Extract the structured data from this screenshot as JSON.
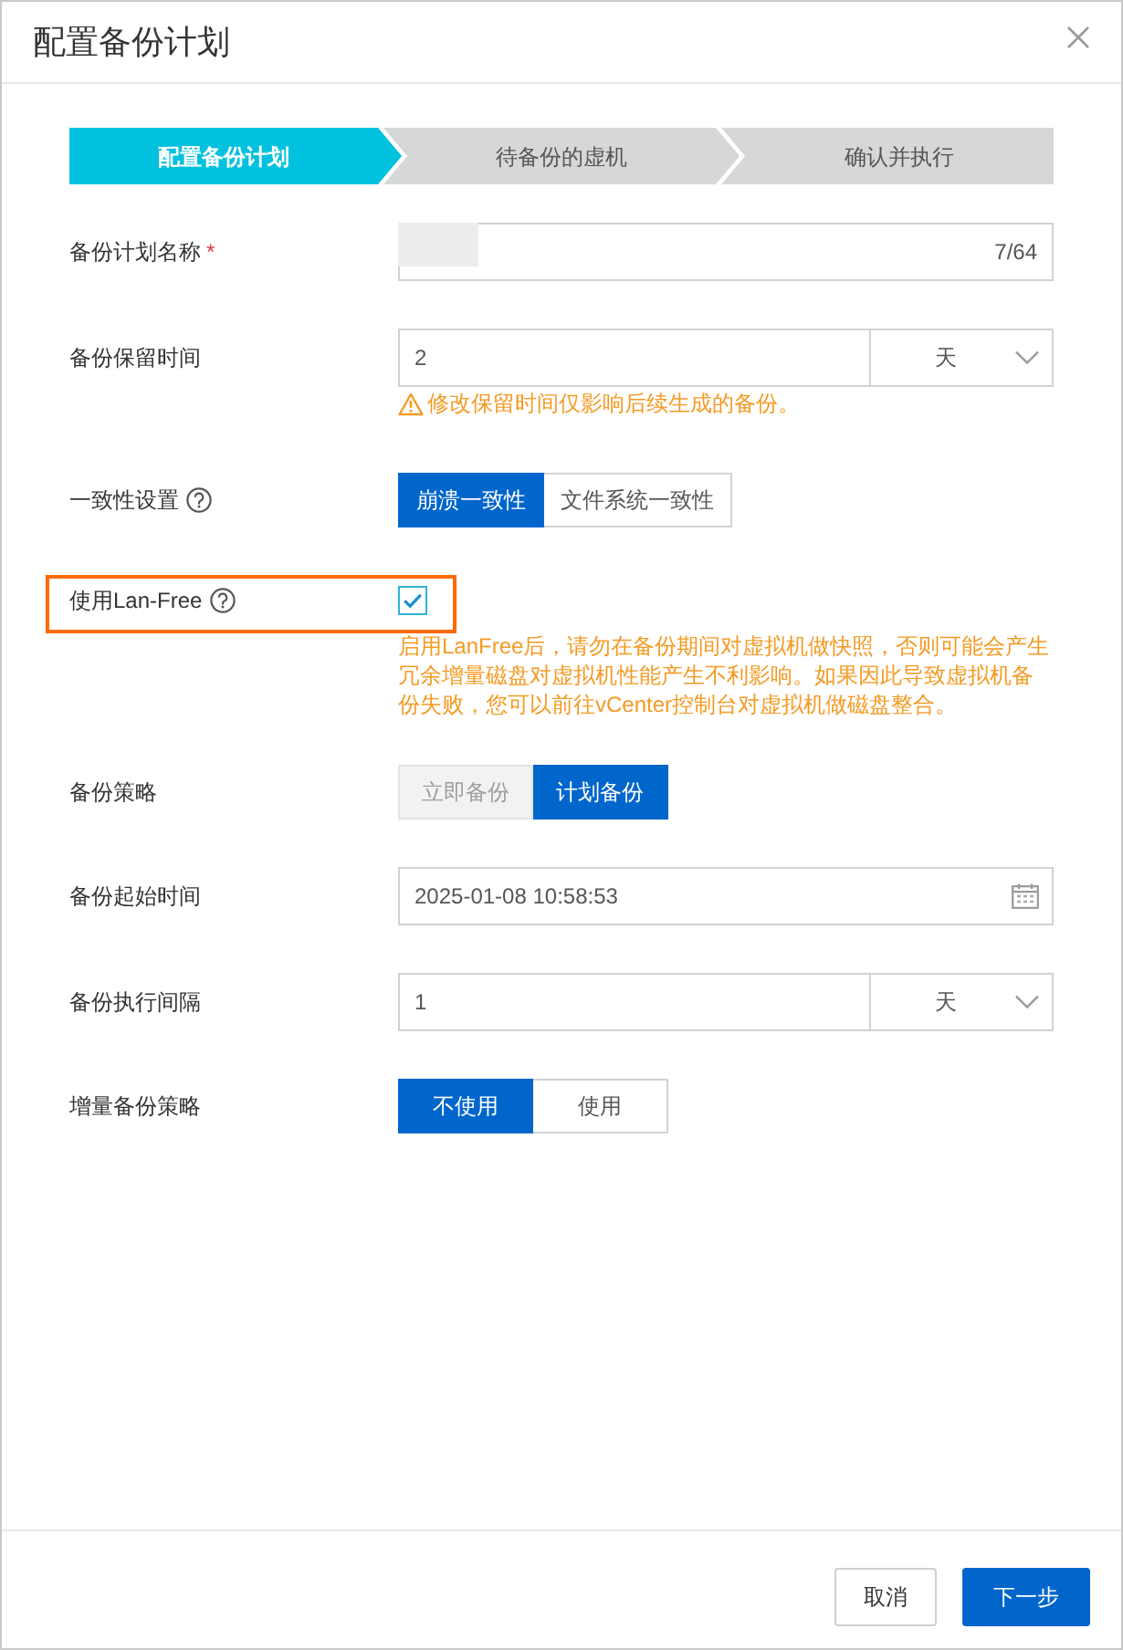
{
  "dialog": {
    "title": "配置备份计划"
  },
  "steps": [
    {
      "label": "配置备份计划",
      "selected": true
    },
    {
      "label": "待备份的虚机",
      "selected": false
    },
    {
      "label": "确认并执行",
      "selected": false
    }
  ],
  "form": {
    "rows": [
      {
        "kind": "text",
        "label": "备份计划名称",
        "required_mark": "*",
        "value_blurred": true,
        "counter": "7/64"
      },
      {
        "kind": "number_unit",
        "label": "备份保留时间",
        "value": "2",
        "unit": "天",
        "warning": "修改保留时间仅影响后续生成的备份。"
      },
      {
        "kind": "segmented",
        "label": "一致性设置",
        "help": true,
        "options": [
          {
            "label": "崩溃一致性",
            "selected": true
          },
          {
            "label": "文件系统一致性",
            "selected": false
          }
        ]
      },
      {
        "kind": "checkbox",
        "label": "使用Lan-Free",
        "help": true,
        "checked": true,
        "highlighted": true,
        "note": "启用LanFree后，请勿在备份期间对虚拟机做快照，否则可能会产生冗余增量磁盘对虚拟机性能产生不利影响。如果因此导致虚拟机备份失败，您可以前往vCenter控制台对虚拟机做磁盘整合。"
      },
      {
        "kind": "segmented",
        "label": "备份策略",
        "options": [
          {
            "label": "立即备份",
            "selected": false,
            "disabled": true
          },
          {
            "label": "计划备份",
            "selected": true,
            "disabled": false
          }
        ]
      },
      {
        "kind": "datetime",
        "label": "备份起始时间",
        "value": "2025-01-08 10:58:53"
      },
      {
        "kind": "number_unit",
        "label": "备份执行间隔",
        "value": "1",
        "unit": "天"
      },
      {
        "kind": "segmented",
        "label": "增量备份策略",
        "options": [
          {
            "label": "不使用",
            "selected": true
          },
          {
            "label": "使用",
            "selected": false
          }
        ]
      }
    ]
  },
  "footer": {
    "buttons": [
      {
        "label": "取消",
        "kind": "cancel"
      },
      {
        "label": "下一步",
        "kind": "next"
      }
    ]
  }
}
